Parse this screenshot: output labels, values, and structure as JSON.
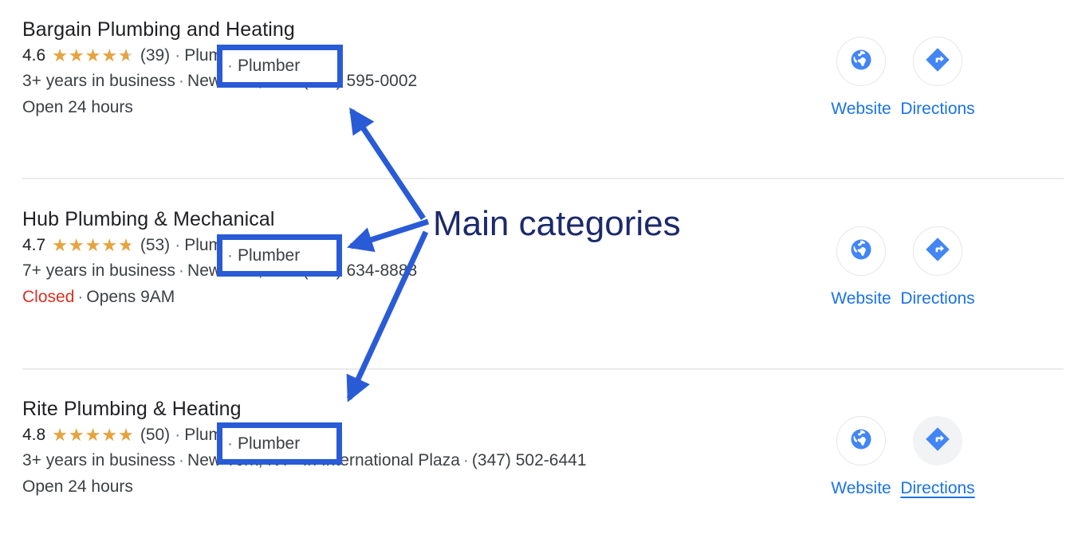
{
  "page": {
    "background_color": "#ffffff",
    "annotation_accent": "#2a5bd7",
    "annotation_text_color": "#1b2a6b",
    "link_color": "#1a73e8",
    "star_color": "#e7a33e",
    "closed_color": "#d93025"
  },
  "annotation": {
    "label": "Main categories",
    "arrow_count": 3,
    "highlight_icon": "highlight-rectangle"
  },
  "listings": [
    {
      "name": "Bargain Plumbing and Heating",
      "rating": "4.6",
      "rating_value": 4.6,
      "review_count": "(39)",
      "separator": "·",
      "category": "Plumber",
      "address_parts": [
        "3+ years in business",
        "New York, NY",
        "(646) 595-0002"
      ],
      "hours_status": "Open 24 hours",
      "hours_status_type": "open",
      "hours_extra": "",
      "actions": [
        {
          "label": "Website",
          "icon": "globe-icon",
          "hovered": false
        },
        {
          "label": "Directions",
          "icon": "directions-diamond-icon",
          "hovered": false
        }
      ]
    },
    {
      "name": "Hub Plumbing & Mechanical",
      "rating": "4.7",
      "rating_value": 4.7,
      "review_count": "(53)",
      "separator": "·",
      "category": "Plumber",
      "address_parts": [
        "7+ years in business",
        "New York, NY",
        "(917) 634-8888"
      ],
      "hours_status": "Closed",
      "hours_status_type": "closed",
      "hours_extra": "Opens 9AM",
      "actions": [
        {
          "label": "Website",
          "icon": "globe-icon",
          "hovered": false
        },
        {
          "label": "Directions",
          "icon": "directions-diamond-icon",
          "hovered": false
        }
      ]
    },
    {
      "name": "Rite Plumbing & Heating",
      "rating": "4.8",
      "rating_value": 4.8,
      "review_count": "(50)",
      "separator": "·",
      "category": "Plumber",
      "address_parts": [
        "3+ years in business",
        "New York, NY",
        "In International Plaza",
        "(347) 502-6441"
      ],
      "hours_status": "Open 24 hours",
      "hours_status_type": "open",
      "hours_extra": "",
      "actions": [
        {
          "label": "Website",
          "icon": "globe-icon",
          "hovered": false
        },
        {
          "label": "Directions",
          "icon": "directions-diamond-icon",
          "hovered": true
        }
      ]
    }
  ]
}
